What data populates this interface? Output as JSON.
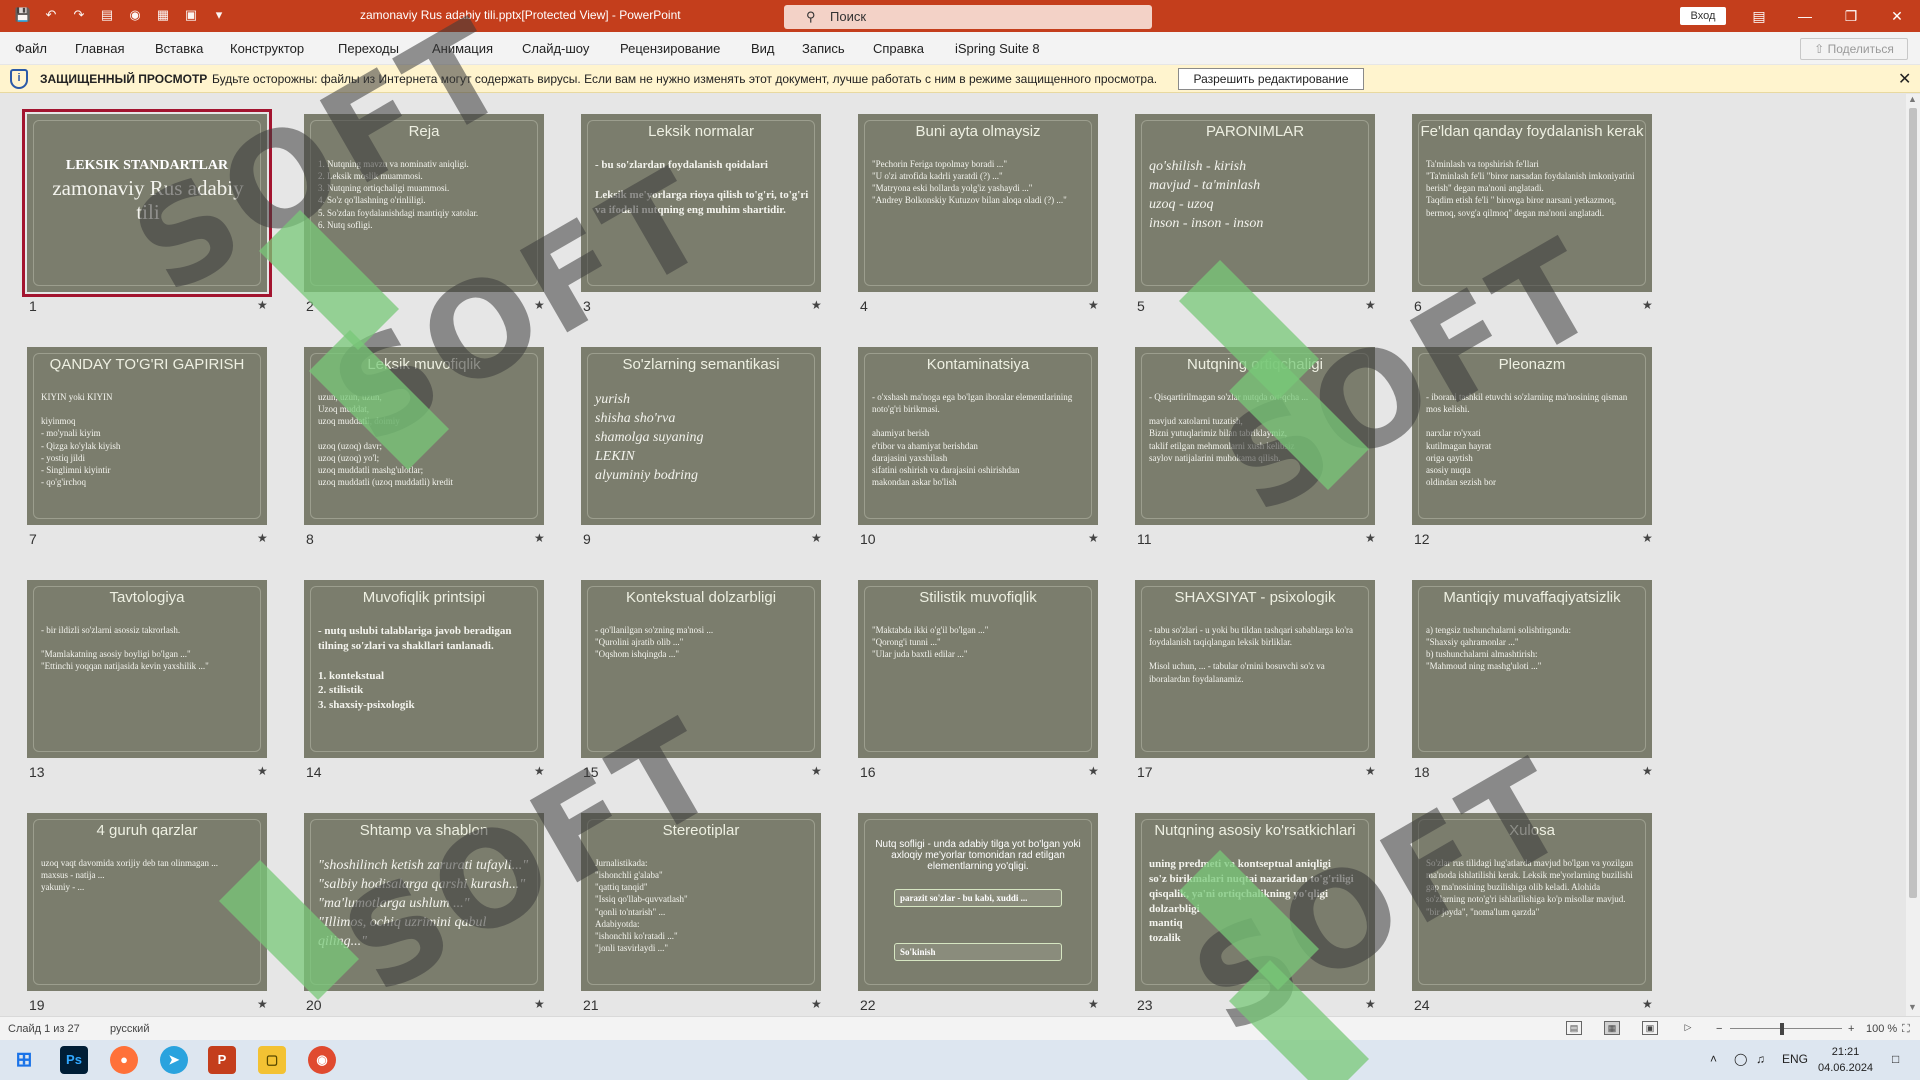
{
  "titlebar": {
    "doc_title": "zamonaviy Rus adabiy tili.pptx[Protected View] - PowerPoint",
    "search_placeholder": "Поиск",
    "login_label": "Вход"
  },
  "menu": {
    "items": [
      "Файл",
      "Главная",
      "Вставка",
      "Конструктор",
      "Переходы",
      "Анимация",
      "Слайд-шоу",
      "Рецензирование",
      "Вид",
      "Запись",
      "Справка",
      "iSpring Suite 8"
    ],
    "share_label": "Поделиться"
  },
  "protected_view": {
    "title": "ЗАЩИЩЕННЫЙ ПРОСМОТР",
    "message": "Будьте осторожны: файлы из Интернета могут содержать вирусы. Если вам не нужно изменять этот документ, лучше работать с ним в режиме защищенного просмотра.",
    "enable_label": "Разрешить редактирование"
  },
  "slides": [
    {
      "num": "1",
      "title": "LEKSIK STANDARTLAR",
      "body": "zamonaviy Rus adabiy tili",
      "style": "s1"
    },
    {
      "num": "2",
      "title": "Reja",
      "body": "1. Nutqning mavzu va nominativ aniqligi.\n2. Leksik moslik muammosi.\n3. Nutqning ortiqchaligi muammosi.\n4. So'z qo'llashning o'rinliligi.\n5. So'zdan foydalanishdagi mantiqiy xatolar.\n6. Nutq sofligi."
    },
    {
      "num": "3",
      "title": "Leksik normalar",
      "body": "- bu so'zlardan foydalanish qoidalari\n\nLeksik me'yorlarga rioya qilish to'g'ri, to'g'ri va ifodali nutqning eng muhim shartidir.",
      "style": "bold"
    },
    {
      "num": "4",
      "title": "Buni ayta olmaysiz",
      "body": "\"Pechorin Feriga topolmay boradi ...\"\n\"U o'zi atrofida kadrli yaratdi (?) ...\"\n\"Matryona eski hollarda yolg'iz yashaydi ...\"\n\"Andrey Bolkonskiy Kutuzov bilan aloqa oladi (?) ...\""
    },
    {
      "num": "5",
      "title": "PARONIMLAR",
      "body": "qo'shilish - kirish\nmavjud - ta'minlash\nuzoq - uzoq\ninson - inson - inson",
      "style": "big"
    },
    {
      "num": "6",
      "title": "Fe'ldan qanday foydalanish kerak",
      "body": "Ta'minlash va topshirish fe'llari\n\"Ta'minlash fe'li \"biror narsadan foydalanish imkoniyatini berish\" degan ma'noni anglatadi.\nTaqdim etish fe'li \" birovga biror narsani yetkazmoq, bermoq, sovg'a qilmoq\" degan ma'noni anglatadi."
    },
    {
      "num": "7",
      "title": "QANDAY TO'G'RI GAPIRISH",
      "body": "KIYIN yoki KIYIN\n\nkiyinmoq\n- mo'ynali kiyim\n- Qizga ko'ylak kiyish\n- yostiq jildi\n- Singlimni kiyintir\n- qo'g'irchoq"
    },
    {
      "num": "8",
      "title": "Leksik muvofiqlik",
      "body": "uzun, uzun, uzun,\nUzoq muddat,\nuzoq muddatli, doimiy\n\nuzoq (uzoq) davr;\nuzoq (uzoq) yo'l;\nuzoq muddatli mashg'ulotlar;\nuzoq muddatli (uzoq muddatli) kredit"
    },
    {
      "num": "9",
      "title": "So'zlarning semantikasi",
      "body": "yurish\nshisha sho'rva\nshamolga suyaning\nLEKIN\nalyuminiy bodring",
      "style": "big"
    },
    {
      "num": "10",
      "title": "Kontaminatsiya",
      "body": "- o'xshash ma'noga ega bo'lgan iboralar elementlarining noto'g'ri birikmasi.\n\nahamiyat berish\ne'tibor va ahamiyat berishdan\ndarajasini yaxshilash\nsifatini oshirish va darajasini oshirishdan\nmakondan askar bo'lish"
    },
    {
      "num": "11",
      "title": "Nutqning ortiqchaligi",
      "body": "- Qisqartirilmagan so'zlar nutqda ortiqcha ...\n\nmavjud xatolarni tuzatish,\nBizni yutuqlarimiz bilan tabriklaymiz,\ntaklif etilgan mehmonlarni xush kelibsiz\nsaylov natijalarini muhokama qilish."
    },
    {
      "num": "12",
      "title": "Pleonazm",
      "body": "- iborani tashkil etuvchi so'zlarning ma'nosining qisman mos kelishi.\n\nnarxlar ro'yxati\nkutilmagan hayrat\noriga qaytish\nasosiy nuqta\noldindan sezish bor"
    },
    {
      "num": "13",
      "title": "Tavtologiya",
      "body": "- bir ildizli so'zlarni asossiz takrorlash.\n\n\"Mamlakatning asosiy boyligi bo'lgan ...\"\n\"Ettinchi yoqqan natijasida kevin yaxshilik ...\""
    },
    {
      "num": "14",
      "title": "Muvofiqlik printsipi",
      "body": "- nutq uslubi talablariga javob beradigan tilning so'zlari va shakllari tanlanadi.\n\n1. kontekstual\n2. stilistik\n3. shaxsiy-psixologik",
      "style": "bold"
    },
    {
      "num": "15",
      "title": "Kontekstual dolzarbligi",
      "body": "- qo'llanilgan so'zning ma'nosi ...\n\"Qurolini ajratib olib ...\"\n\"Oqshom ishqingda ...\""
    },
    {
      "num": "16",
      "title": "Stilistik muvofiqlik",
      "body": "\"Maktabda ikki o'g'il bo'lgan ...\"\n\"Qorong'i tunni ...\"\n\"Ular juda baxtli edilar ...\""
    },
    {
      "num": "17",
      "title": "SHAXSIYAT - psixologik",
      "body": "- tabu so'zlari - u yoki bu tildan tashqari sabablarga ko'ra foydalanish taqiqlangan leksik birliklar.\n\nMisol uchun, ... - tabular o'rnini bosuvchi so'z va iboralardan foydalanamiz."
    },
    {
      "num": "18",
      "title": "Mantiqiy muvaffaqiyatsizlik",
      "body": "a) tengsiz tushunchalarni solishtirganda:\n\"Shaxsiy qahramonlar ...\"\nb) tushunchalarni almashtirish:\n\"Mahmoud ning mashg'uloti ...\""
    },
    {
      "num": "19",
      "title": "4 guruh qarzlar",
      "body": "uzoq vaqt davomida xorijiy deb tan olinmagan ... \nmaxsus - natija ...\nyakuniy - ..."
    },
    {
      "num": "20",
      "title": "Shtamp va shablon",
      "body": "\"shoshilinch ketish zarurati tufayli...\"\n\"salbiy hodisalarga qarshi kurash...\"\n\"ma'lumotlarga ushlum ...\"\n\"Illimos, ochiq uzrimini qabul qiling...\"",
      "style": "big"
    },
    {
      "num": "21",
      "title": "Stereotiplar",
      "body": "Jurnalistikada:\n\"ishonchli g'alaba\"\n\"qattiq tanqid\"\n\"Issiq qo'llab-quvvatlash\"\n\"qonli to'ntarish\" ...\nAdabiyotda:\n\"ishonchli ko'ratadi ...\"\n\"jonli tasvirlaydi ...\""
    },
    {
      "num": "22",
      "title": "Nutq sofligi - unda adabiy tilga yot bo'lgan yoki axloqiy me'yorlar tomonidan rad etilgan elementlarning yo'qligi.",
      "box1": "parazit so'zlar - bu kabi, xuddi ...",
      "box2": "So'kinish",
      "style": "s22"
    },
    {
      "num": "23",
      "title": "Nutqning asosiy ko'rsatkichlari",
      "body": "uning predmeti va kontseptual aniqligi\nso'z birikmalari nuqtai nazaridan to'g'riligi\nqisqalik, ya'ni ortiqchalikning yo'qligi\ndolzarbligi\nmantiq\ntozalik",
      "style": "bold"
    },
    {
      "num": "24",
      "title": "Xulosa",
      "body": "So'zlar rus tilidagi lug'atlarda mavjud bo'lgan va yozilgan ma'noda ishlatilishi kerak. Leksik me'yorlarning buzilishi gap ma'nosining buzilishiga olib keladi. Alohida so'zlarning noto'g'ri ishlatilishiga ko'p misollar mavjud.\n\"bir joyda\", \"noma'lum qarzda\""
    }
  ],
  "watermark": {
    "text": "SOFT",
    "color": "#3c3c3c",
    "accent": "#78c878"
  },
  "statusbar": {
    "slide_info": "Слайд 1 из 27",
    "language": "русский",
    "zoom": "100 %"
  },
  "taskbar": {
    "time": "21:21",
    "date": "04.06.2024",
    "lang": "ENG",
    "apps": [
      "windows-start",
      "photoshop",
      "firefox",
      "telegram",
      "powerpoint",
      "explorer",
      "chrome"
    ]
  },
  "colors": {
    "accent": "#c43e1c",
    "slide_bg": "#7b7d6d",
    "selected": "#a3142f"
  }
}
